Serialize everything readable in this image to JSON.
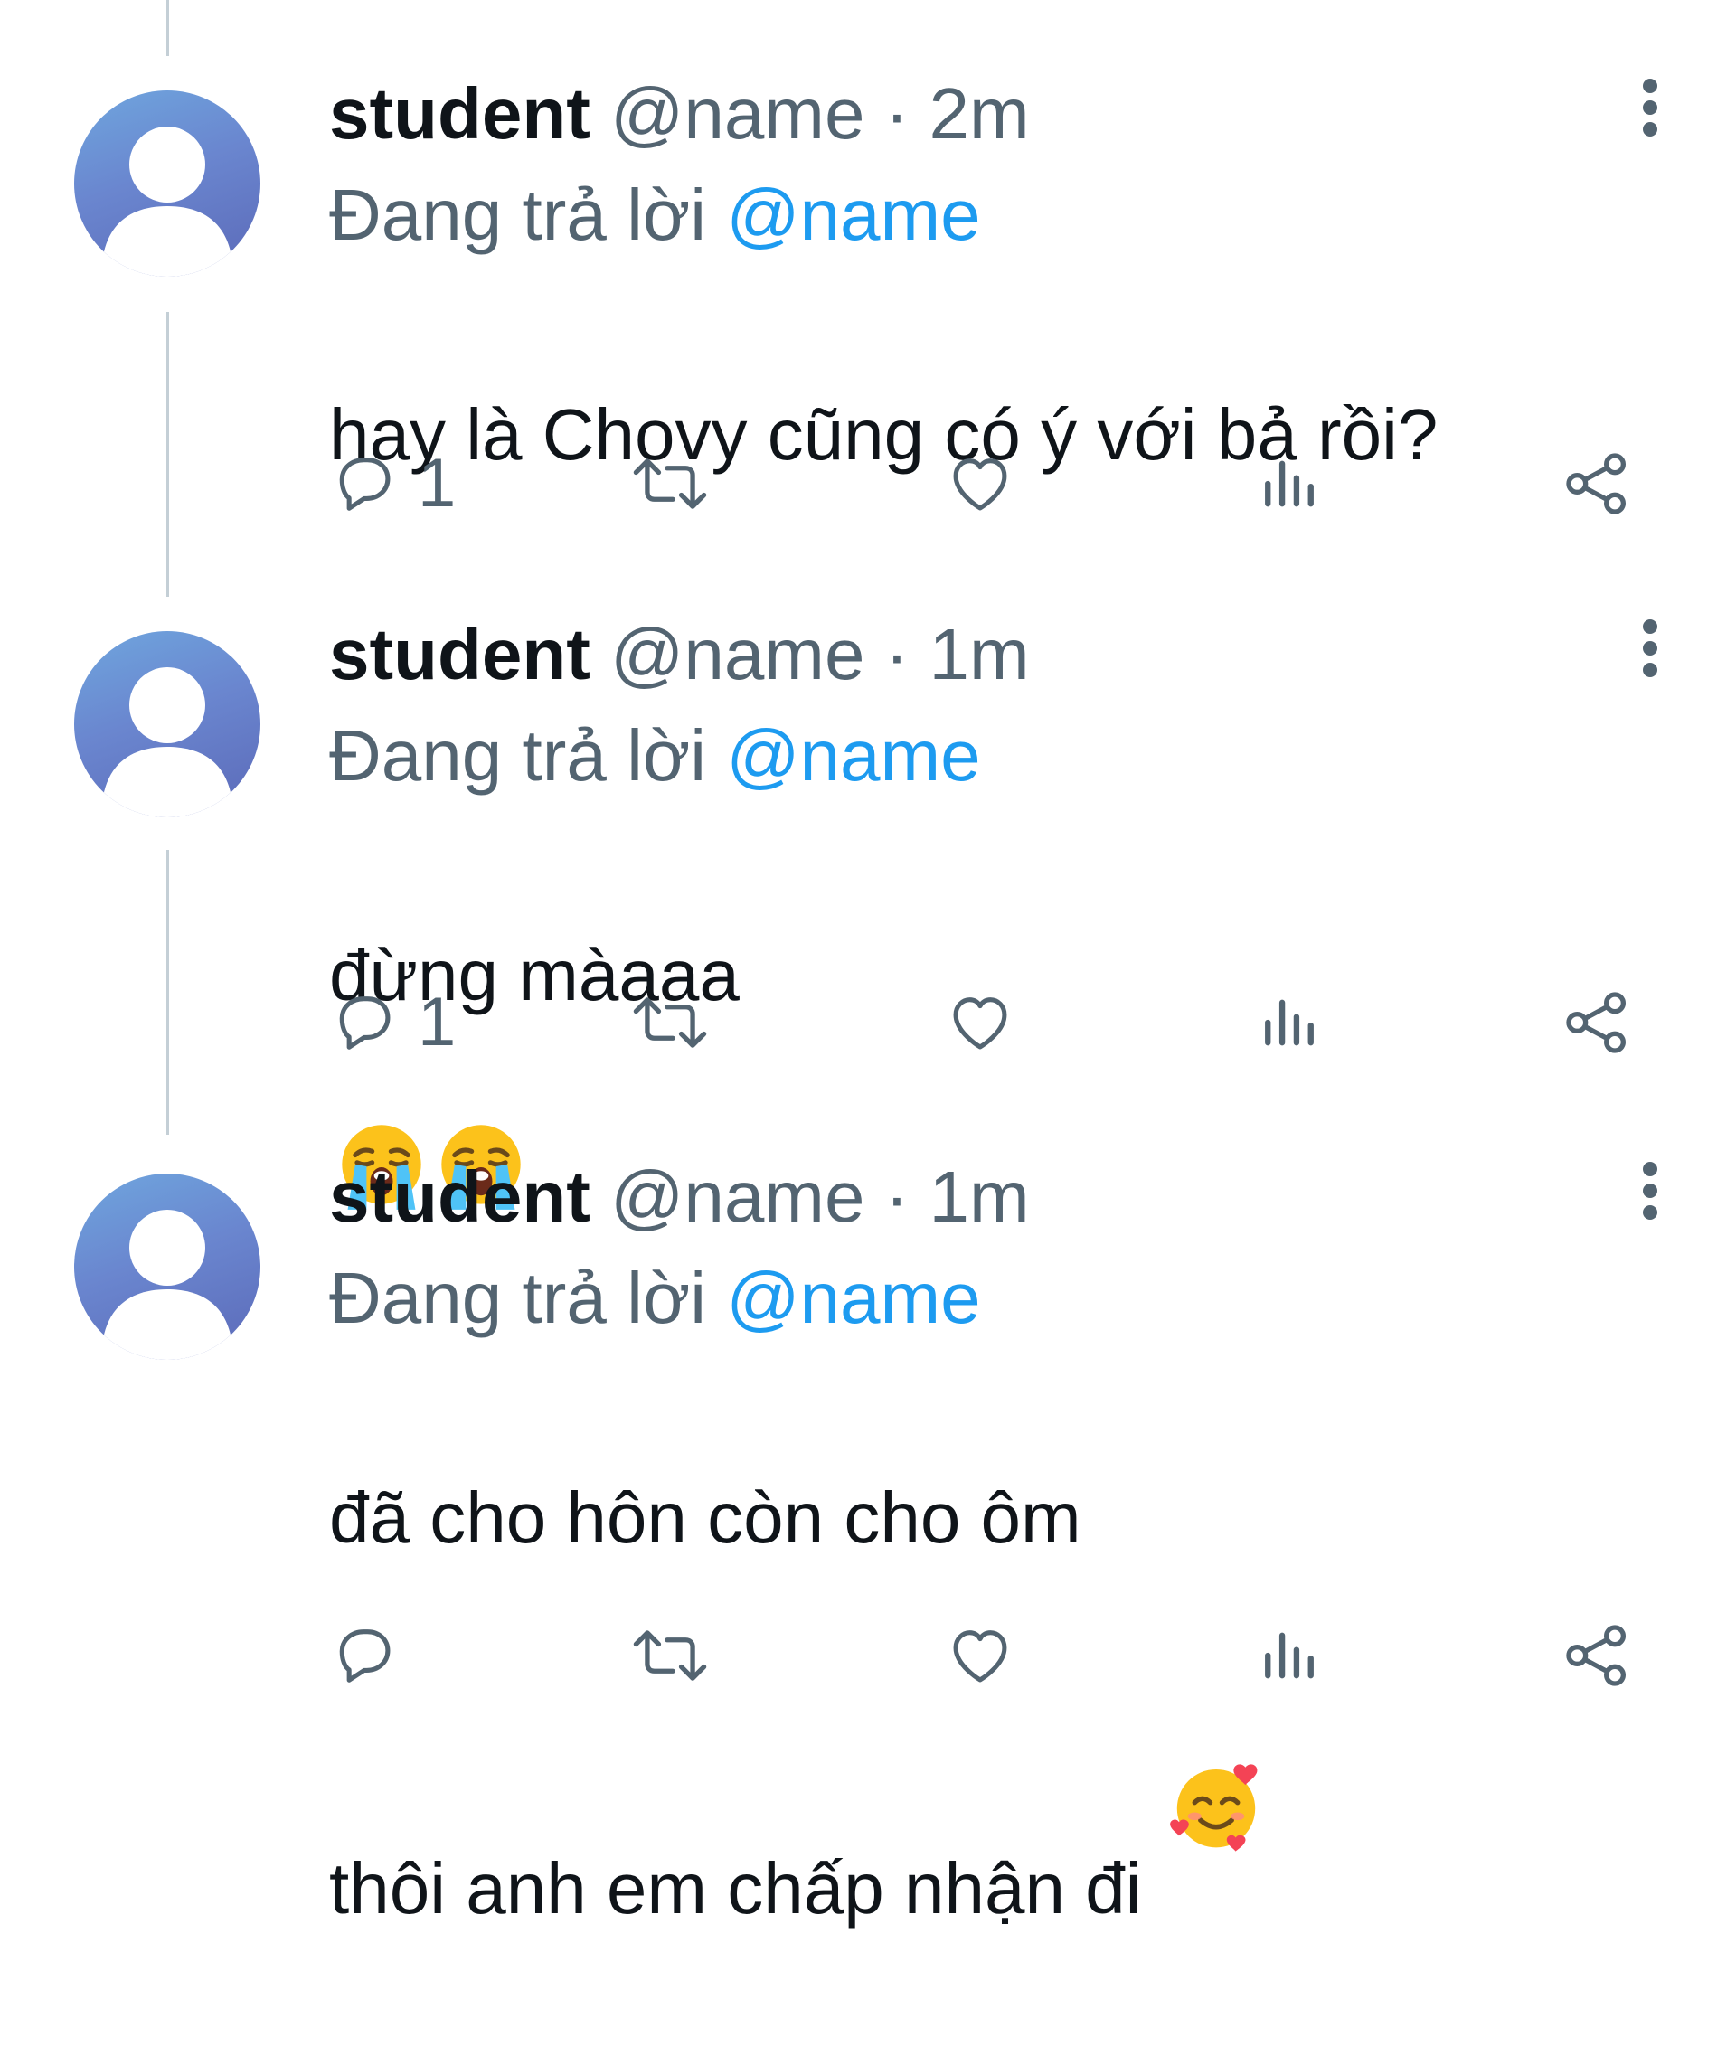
{
  "tweets": [
    {
      "display_name": "student",
      "handle": "@name",
      "separator": "·",
      "time": "2m",
      "reply_prefix": "Đang trả lời",
      "reply_to": "@name",
      "text": "hay là Chovy cũng có ý với bả rồi?",
      "emojis": [],
      "reply_count": "1",
      "icons": [
        "comment-icon",
        "retweet-icon",
        "heart-icon",
        "views-icon",
        "share-icon",
        "more-vertical-icon"
      ]
    },
    {
      "display_name": "student",
      "handle": "@name",
      "separator": "·",
      "time": "1m",
      "reply_prefix": "Đang trả lời",
      "reply_to": "@name",
      "text": "đừng màaaa",
      "emojis": [
        "loudly-crying-face-emoji",
        "loudly-crying-face-emoji"
      ],
      "reply_count": "1",
      "icons": [
        "comment-icon",
        "retweet-icon",
        "heart-icon",
        "views-icon",
        "share-icon",
        "more-vertical-icon"
      ]
    },
    {
      "display_name": "student",
      "handle": "@name",
      "separator": "·",
      "time": "1m",
      "reply_prefix": "Đang trả lời",
      "reply_to": "@name",
      "text_line1": "đã cho hôn còn cho ôm",
      "text_line2": "thôi anh em chấp nhận đi",
      "emojis": [
        "smiling-face-with-hearts-emoji"
      ],
      "reply_count": "",
      "icons": [
        "comment-icon",
        "retweet-icon",
        "heart-icon",
        "views-icon",
        "share-icon",
        "more-vertical-icon"
      ]
    }
  ],
  "colors": {
    "text": "#0f1419",
    "secondary": "#536471",
    "link": "#1d9bf0",
    "thread_line": "#c4cfd6",
    "avatar": "#6a86cf"
  }
}
